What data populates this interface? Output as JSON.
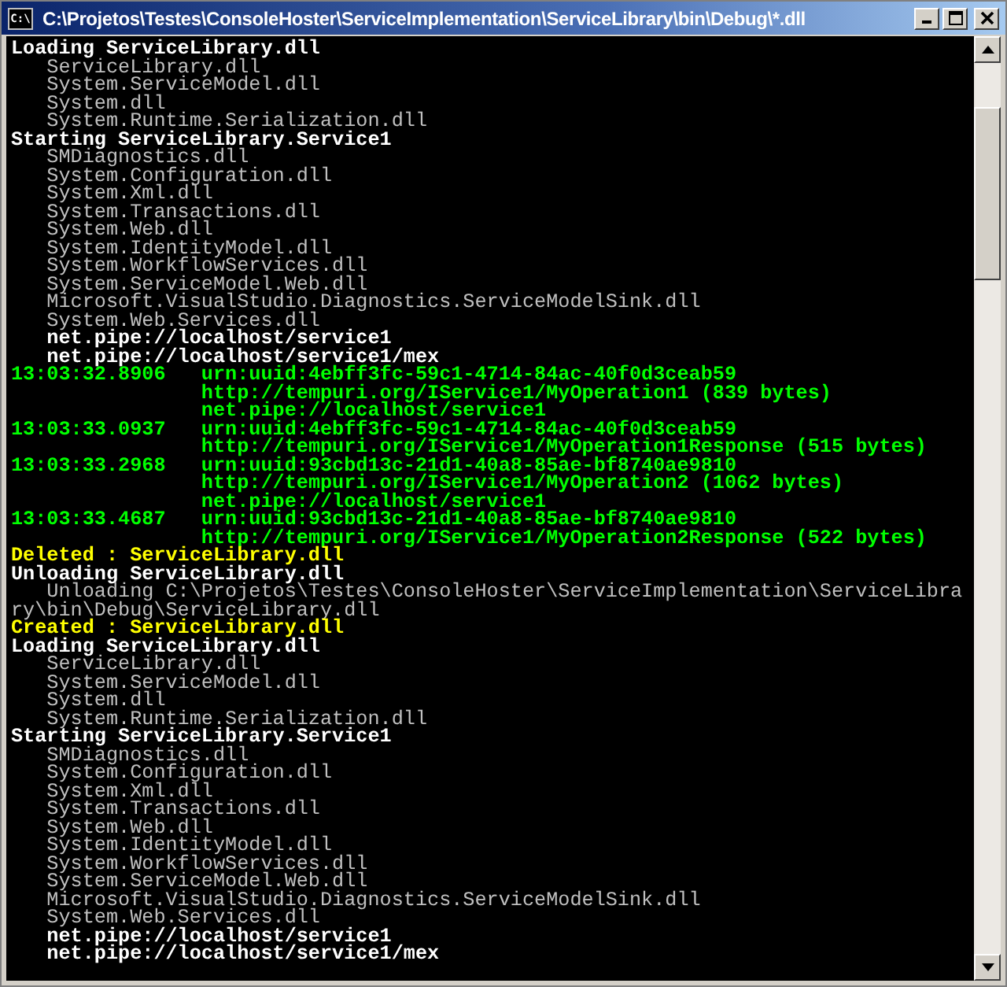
{
  "window": {
    "title": "C:\\Projetos\\Testes\\ConsoleHoster\\ServiceImplementation\\ServiceLibrary\\bin\\Debug\\*.dll",
    "icon_text": "C:\\"
  },
  "console": {
    "lines": [
      {
        "kind": "header",
        "text": "Loading ServiceLibrary.dll"
      },
      {
        "kind": "item",
        "text": "ServiceLibrary.dll"
      },
      {
        "kind": "item",
        "text": "System.ServiceModel.dll"
      },
      {
        "kind": "item",
        "text": "System.dll"
      },
      {
        "kind": "item",
        "text": "System.Runtime.Serialization.dll"
      },
      {
        "kind": "header",
        "text": "Starting ServiceLibrary.Service1"
      },
      {
        "kind": "item",
        "text": "SMDiagnostics.dll"
      },
      {
        "kind": "item",
        "text": "System.Configuration.dll"
      },
      {
        "kind": "item",
        "text": "System.Xml.dll"
      },
      {
        "kind": "item",
        "text": "System.Transactions.dll"
      },
      {
        "kind": "item",
        "text": "System.Web.dll"
      },
      {
        "kind": "item",
        "text": "System.IdentityModel.dll"
      },
      {
        "kind": "item",
        "text": "System.WorkflowServices.dll"
      },
      {
        "kind": "item",
        "text": "System.ServiceModel.Web.dll"
      },
      {
        "kind": "item",
        "text": "Microsoft.VisualStudio.Diagnostics.ServiceModelSink.dll"
      },
      {
        "kind": "item",
        "text": "System.Web.Services.dll"
      },
      {
        "kind": "endpoint",
        "text": "net.pipe://localhost/service1"
      },
      {
        "kind": "endpoint",
        "text": "net.pipe://localhost/service1/mex"
      },
      {
        "kind": "log",
        "time": "13:03:32.8906",
        "messages": [
          "urn:uuid:4ebff3fc-59c1-4714-84ac-40f0d3ceab59",
          "http://tempuri.org/IService1/MyOperation1 (839 bytes)",
          "net.pipe://localhost/service1"
        ]
      },
      {
        "kind": "log",
        "time": "13:03:33.0937",
        "messages": [
          "urn:uuid:4ebff3fc-59c1-4714-84ac-40f0d3ceab59",
          "http://tempuri.org/IService1/MyOperation1Response (515 bytes)"
        ]
      },
      {
        "kind": "log",
        "time": "13:03:33.2968",
        "messages": [
          "urn:uuid:93cbd13c-21d1-40a8-85ae-bf8740ae9810",
          "http://tempuri.org/IService1/MyOperation2 (1062 bytes)",
          "net.pipe://localhost/service1"
        ]
      },
      {
        "kind": "log",
        "time": "13:03:33.4687",
        "messages": [
          "urn:uuid:93cbd13c-21d1-40a8-85ae-bf8740ae9810",
          "http://tempuri.org/IService1/MyOperation2Response (522 bytes)"
        ]
      },
      {
        "kind": "event",
        "text": "Deleted : ServiceLibrary.dll"
      },
      {
        "kind": "header",
        "text": "Unloading ServiceLibrary.dll"
      },
      {
        "kind": "detail",
        "text": "Unloading C:\\Projetos\\Testes\\ConsoleHoster\\ServiceImplementation\\ServiceLibrary\\bin\\Debug\\ServiceLibrary.dll"
      },
      {
        "kind": "event",
        "text": "Created : ServiceLibrary.dll"
      },
      {
        "kind": "header",
        "text": "Loading ServiceLibrary.dll"
      },
      {
        "kind": "item",
        "text": "ServiceLibrary.dll"
      },
      {
        "kind": "item",
        "text": "System.ServiceModel.dll"
      },
      {
        "kind": "item",
        "text": "System.dll"
      },
      {
        "kind": "item",
        "text": "System.Runtime.Serialization.dll"
      },
      {
        "kind": "header",
        "text": "Starting ServiceLibrary.Service1"
      },
      {
        "kind": "item",
        "text": "SMDiagnostics.dll"
      },
      {
        "kind": "item",
        "text": "System.Configuration.dll"
      },
      {
        "kind": "item",
        "text": "System.Xml.dll"
      },
      {
        "kind": "item",
        "text": "System.Transactions.dll"
      },
      {
        "kind": "item",
        "text": "System.Web.dll"
      },
      {
        "kind": "item",
        "text": "System.IdentityModel.dll"
      },
      {
        "kind": "item",
        "text": "System.WorkflowServices.dll"
      },
      {
        "kind": "item",
        "text": "System.ServiceModel.Web.dll"
      },
      {
        "kind": "item",
        "text": "Microsoft.VisualStudio.Diagnostics.ServiceModelSink.dll"
      },
      {
        "kind": "item",
        "text": "System.Web.Services.dll"
      },
      {
        "kind": "endpoint",
        "text": "net.pipe://localhost/service1"
      },
      {
        "kind": "endpoint",
        "text": "net.pipe://localhost/service1/mex"
      }
    ]
  }
}
